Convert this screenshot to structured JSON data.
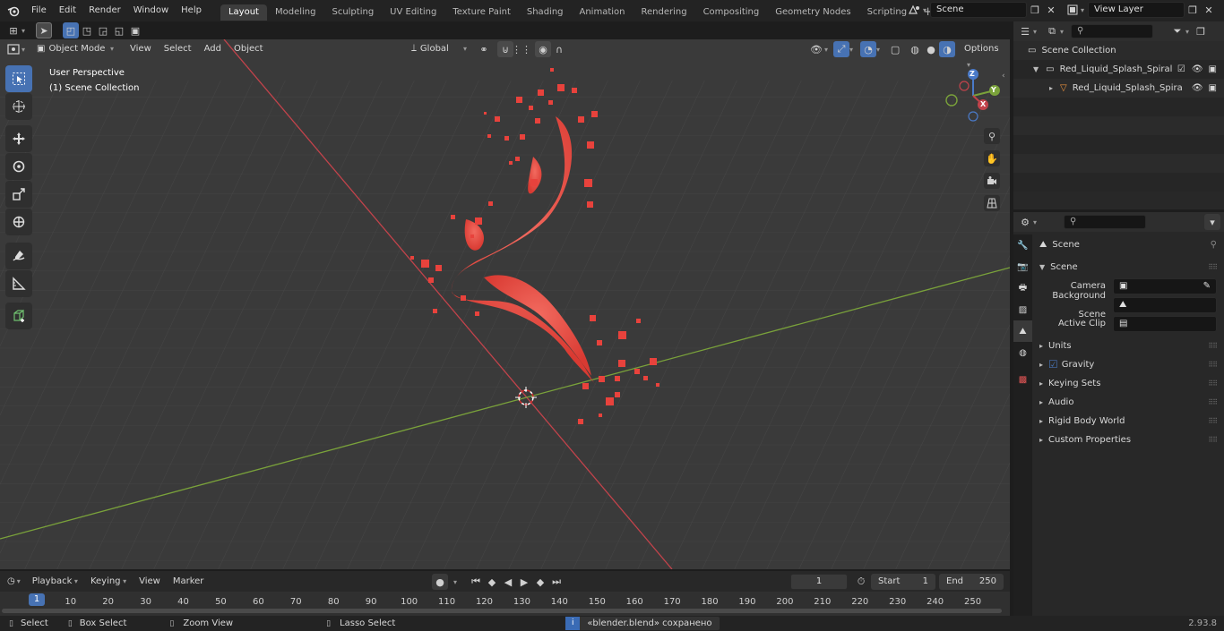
{
  "menu": [
    "File",
    "Edit",
    "Render",
    "Window",
    "Help"
  ],
  "workspaces": [
    {
      "label": "Layout",
      "active": true
    },
    {
      "label": "Modeling"
    },
    {
      "label": "Sculpting"
    },
    {
      "label": "UV Editing"
    },
    {
      "label": "Texture Paint"
    },
    {
      "label": "Shading"
    },
    {
      "label": "Animation"
    },
    {
      "label": "Rendering"
    },
    {
      "label": "Compositing"
    },
    {
      "label": "Geometry Nodes"
    },
    {
      "label": "Scripting"
    }
  ],
  "add_workspace": "+",
  "scene_field": "Scene",
  "view_layer_field": "View Layer",
  "viewport": {
    "mode": "Object Mode",
    "menus": [
      "View",
      "Select",
      "Add",
      "Object"
    ],
    "transform_orientation": "Global",
    "options_label": "Options",
    "overlay_line1": "User Perspective",
    "overlay_line2": "(1) Scene Collection",
    "gizmo": {
      "z": "Z",
      "y": "Y",
      "x": "X"
    }
  },
  "outliner": {
    "root": "Scene Collection",
    "collection": "Red_Liquid_Splash_Spiral",
    "object": "Red_Liquid_Splash_Spira"
  },
  "properties": {
    "header": "Scene",
    "section": "Scene",
    "fields": [
      {
        "label": "Camera"
      },
      {
        "label": "Background Scene"
      },
      {
        "label": "Active Clip"
      }
    ],
    "panels": [
      "Units",
      "Gravity",
      "Keying Sets",
      "Audio",
      "Rigid Body World",
      "Custom Properties"
    ],
    "gravity_checked": true
  },
  "timeline": {
    "menus": [
      "Playback",
      "Keying",
      "View",
      "Marker"
    ],
    "current_frame": "1",
    "start_label": "Start",
    "start_value": "1",
    "end_label": "End",
    "end_value": "250",
    "ticks": [
      "1",
      "10",
      "20",
      "30",
      "40",
      "50",
      "60",
      "70",
      "80",
      "90",
      "100",
      "110",
      "120",
      "130",
      "140",
      "150",
      "160",
      "170",
      "180",
      "190",
      "200",
      "210",
      "220",
      "230",
      "240",
      "250"
    ]
  },
  "status": {
    "select": "Select",
    "box_select": "Box Select",
    "zoom_view": "Zoom View",
    "lasso_select": "Lasso Select",
    "message": "«blender.blend» сохранено",
    "version": "2.93.8"
  },
  "colors": {
    "accent": "#4772b3",
    "object": "#e8423c",
    "x_axis": "#c2434b",
    "y_axis": "#7aa23a"
  }
}
